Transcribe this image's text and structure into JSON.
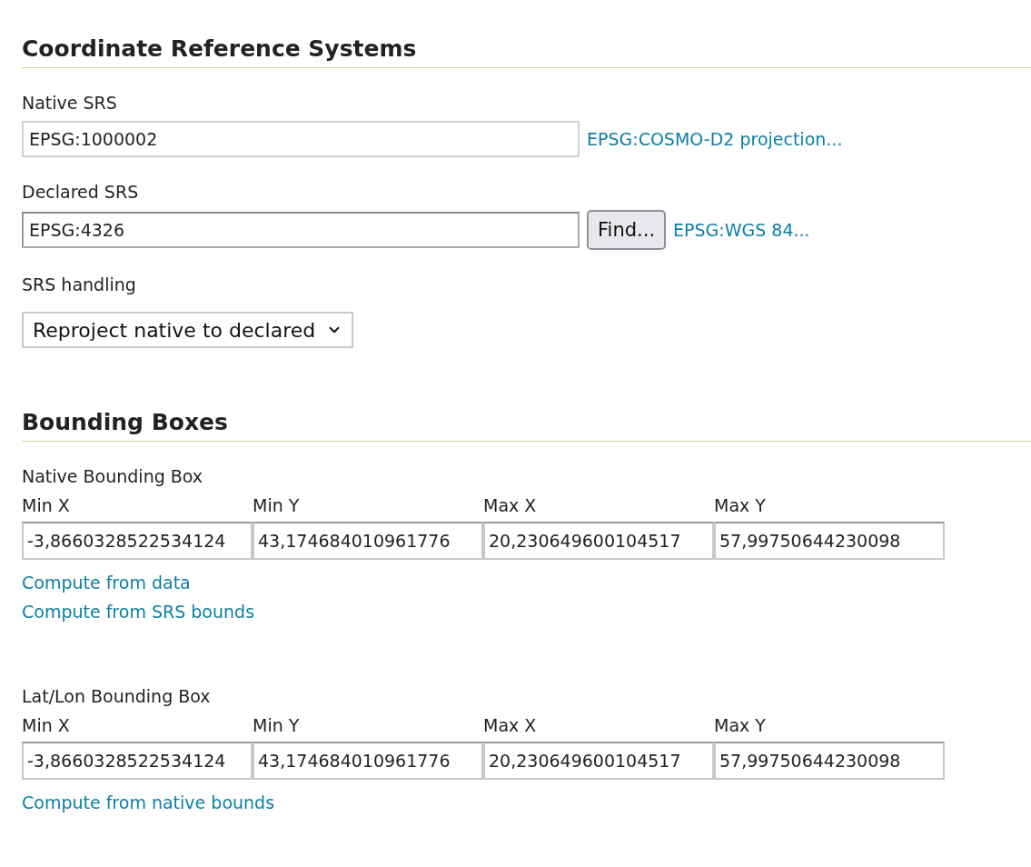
{
  "crs_section": {
    "title": "Coordinate Reference Systems",
    "native_srs": {
      "label": "Native SRS",
      "value": "EPSG:1000002",
      "link": "EPSG:COSMO-D2 projection..."
    },
    "declared_srs": {
      "label": "Declared SRS",
      "value": "EPSG:4326",
      "button": "Find...",
      "link": "EPSG:WGS 84..."
    },
    "srs_handling": {
      "label": "SRS handling",
      "value": "Reproject native to declared"
    }
  },
  "bbox_section": {
    "title": "Bounding Boxes",
    "boxes": [
      {
        "label": "Native Bounding Box",
        "fields": [
          {
            "label": "Min X",
            "value": "-3,8660328522534124"
          },
          {
            "label": "Min Y",
            "value": "43,174684010961776"
          },
          {
            "label": "Max X",
            "value": "20,230649600104517"
          },
          {
            "label": "Max Y",
            "value": "57,99750644230098"
          }
        ],
        "links": [
          "Compute from data",
          "Compute from SRS bounds"
        ]
      },
      {
        "label": "Lat/Lon Bounding Box",
        "fields": [
          {
            "label": "Min X",
            "value": "-3,8660328522534124"
          },
          {
            "label": "Min Y",
            "value": "43,174684010961776"
          },
          {
            "label": "Max X",
            "value": "20,230649600104517"
          },
          {
            "label": "Max Y",
            "value": "57,99750644230098"
          }
        ],
        "links": [
          "Compute from native bounds"
        ]
      }
    ]
  }
}
